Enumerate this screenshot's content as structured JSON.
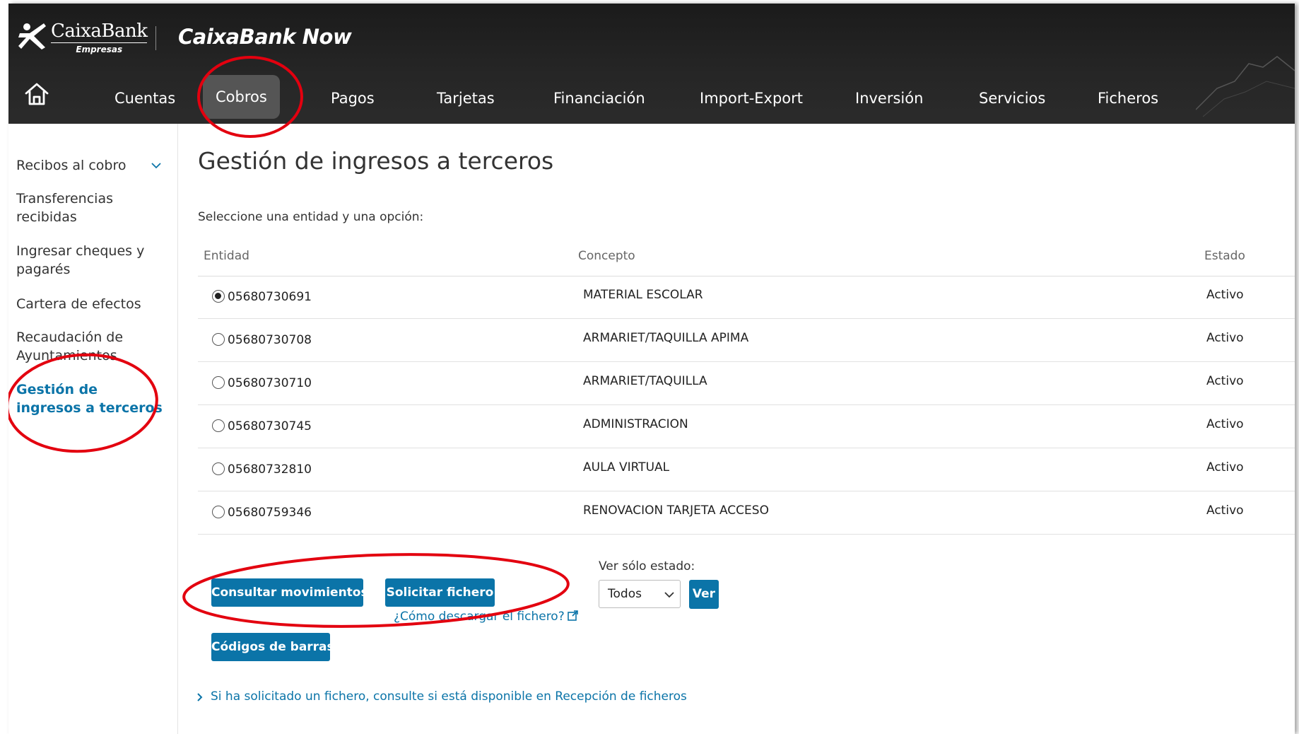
{
  "header": {
    "brand": "CaixaBank",
    "brand_sub": "Empresas",
    "product": "CaixaBank Now",
    "nav": [
      {
        "label": "Cuentas"
      },
      {
        "label": "Cobros",
        "active": true
      },
      {
        "label": "Pagos"
      },
      {
        "label": "Tarjetas"
      },
      {
        "label": "Financiación"
      },
      {
        "label": "Import-Export"
      },
      {
        "label": "Inversión"
      },
      {
        "label": "Servicios"
      },
      {
        "label": "Ficheros"
      }
    ]
  },
  "sidebar": {
    "items": [
      {
        "label": "Recibos al cobro"
      },
      {
        "label": "Transferencias recibidas"
      },
      {
        "label": "Ingresar cheques y pagarés"
      },
      {
        "label": "Cartera de efectos"
      },
      {
        "label": "Recaudación de Ayuntamientos"
      },
      {
        "label": "Gestión de ingresos a terceros",
        "active": true
      }
    ]
  },
  "main": {
    "title": "Gestión de ingresos a terceros",
    "instruction": "Seleccione una entidad y una opción:",
    "table": {
      "headers": [
        "Entidad",
        "Concepto",
        "Estado"
      ],
      "rows": [
        {
          "entidad": "05680730691",
          "concepto": "MATERIAL ESCOLAR",
          "estado": "Activo",
          "selected": true
        },
        {
          "entidad": "05680730708",
          "concepto": "ARMARIET/TAQUILLA APIMA",
          "estado": "Activo",
          "selected": false
        },
        {
          "entidad": "05680730710",
          "concepto": "ARMARIET/TAQUILLA",
          "estado": "Activo",
          "selected": false
        },
        {
          "entidad": "05680730745",
          "concepto": "ADMINISTRACION",
          "estado": "Activo",
          "selected": false
        },
        {
          "entidad": "05680732810",
          "concepto": "AULA VIRTUAL",
          "estado": "Activo",
          "selected": false
        },
        {
          "entidad": "05680759346",
          "concepto": "RENOVACION TARJETA ACCESO",
          "estado": "Activo",
          "selected": false
        }
      ]
    },
    "buttons": {
      "consultar": "Consultar movimientos",
      "solicitar": "Solicitar fichero",
      "codigos": "Códigos de barras",
      "ver": "Ver"
    },
    "help_link": "¿Cómo descargar el fichero?",
    "filter": {
      "label": "Ver sólo estado:",
      "value": "Todos"
    },
    "footer_link": "Si ha solicitado un fichero, consulte si está disponible en Recepción de ficheros"
  },
  "colors": {
    "accent": "#0b74a8",
    "annotation": "#e3000f",
    "header_bg": "#222222",
    "nav_active_bg": "#555555"
  }
}
